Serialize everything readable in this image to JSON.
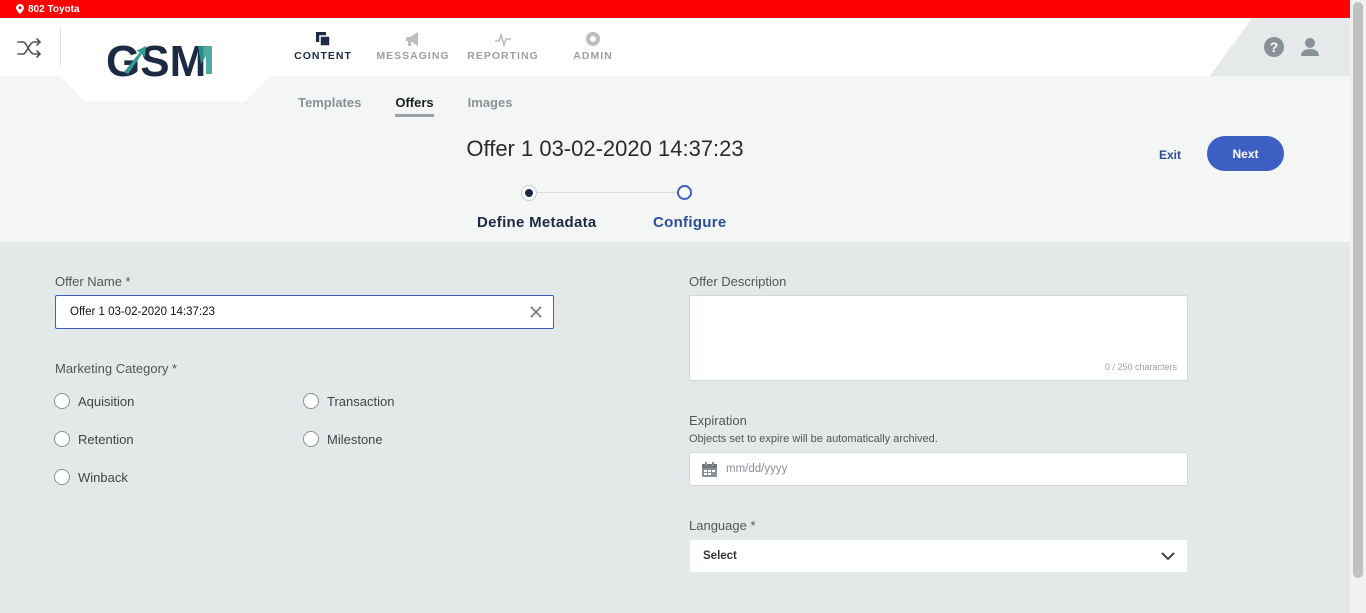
{
  "topbar": {
    "location": "802 Toyota"
  },
  "nav": {
    "items": [
      {
        "label": "CONTENT",
        "icon": "content-icon",
        "active": true
      },
      {
        "label": "MESSAGING",
        "icon": "megaphone-icon",
        "active": false
      },
      {
        "label": "REPORTING",
        "icon": "pulse-icon",
        "active": false
      },
      {
        "label": "ADMIN",
        "icon": "gear-icon",
        "active": false
      }
    ]
  },
  "logo": {
    "text": "GSM"
  },
  "subtabs": [
    {
      "label": "Templates",
      "active": false
    },
    {
      "label": "Offers",
      "active": true
    },
    {
      "label": "Images",
      "active": false
    }
  ],
  "page": {
    "title": "Offer 1 03-02-2020 14:37:23",
    "exit_label": "Exit",
    "next_label": "Next"
  },
  "steps": [
    {
      "label": "Define Metadata",
      "state": "current"
    },
    {
      "label": "Configure",
      "state": "next"
    }
  ],
  "form": {
    "offer_name": {
      "label": "Offer Name *",
      "value": "Offer 1 03-02-2020 14:37:23"
    },
    "marketing_category": {
      "label": "Marketing Category *",
      "options": [
        "Aquisition",
        "Transaction",
        "Retention",
        "Milestone",
        "Winback"
      ]
    },
    "offer_description": {
      "label": "Offer Description",
      "char_count": "0 / 250 characters"
    },
    "expiration": {
      "label": "Expiration",
      "help": "Objects set to expire will be automatically archived.",
      "placeholder": "mm/dd/yyyy"
    },
    "language": {
      "label": "Language *",
      "selected": "Select"
    }
  },
  "colors": {
    "topbar": "#ff0000",
    "primary": "#3d5ec3",
    "navy": "#1d2a44",
    "logo_teal": "#2e9c92"
  }
}
